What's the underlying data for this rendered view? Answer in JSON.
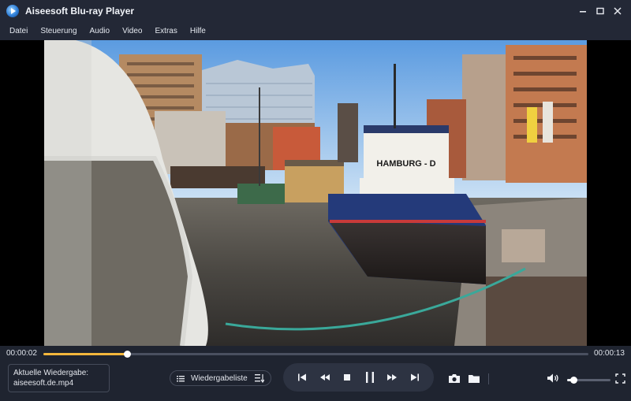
{
  "window": {
    "title": "Aiseesoft Blu-ray Player",
    "controls": [
      "minimize-icon",
      "maximize-icon",
      "close-icon"
    ]
  },
  "menu": {
    "items": [
      {
        "label": "Datei"
      },
      {
        "label": "Steuerung"
      },
      {
        "label": "Audio"
      },
      {
        "label": "Video"
      },
      {
        "label": "Extras"
      },
      {
        "label": "Hilfe"
      }
    ]
  },
  "video": {
    "boat_name": "HAMBURG - D"
  },
  "playback": {
    "current_time": "00:00:02",
    "total_time": "00:00:13",
    "progress": 0.153,
    "now_playing_label": "Aktuelle Wiedergabe:",
    "now_playing_file": "aiseesoft.de.mp4"
  },
  "controls": {
    "playlist_label": "Wiedergabeliste",
    "transport": [
      "skip-start-icon",
      "rewind-icon",
      "stop-icon",
      "pause-icon",
      "fast-forward-icon",
      "skip-end-icon"
    ],
    "volume": 0.15
  },
  "colors": {
    "accent": "#f4b73c",
    "background": "#1f2430",
    "title_bar": "#232836"
  }
}
